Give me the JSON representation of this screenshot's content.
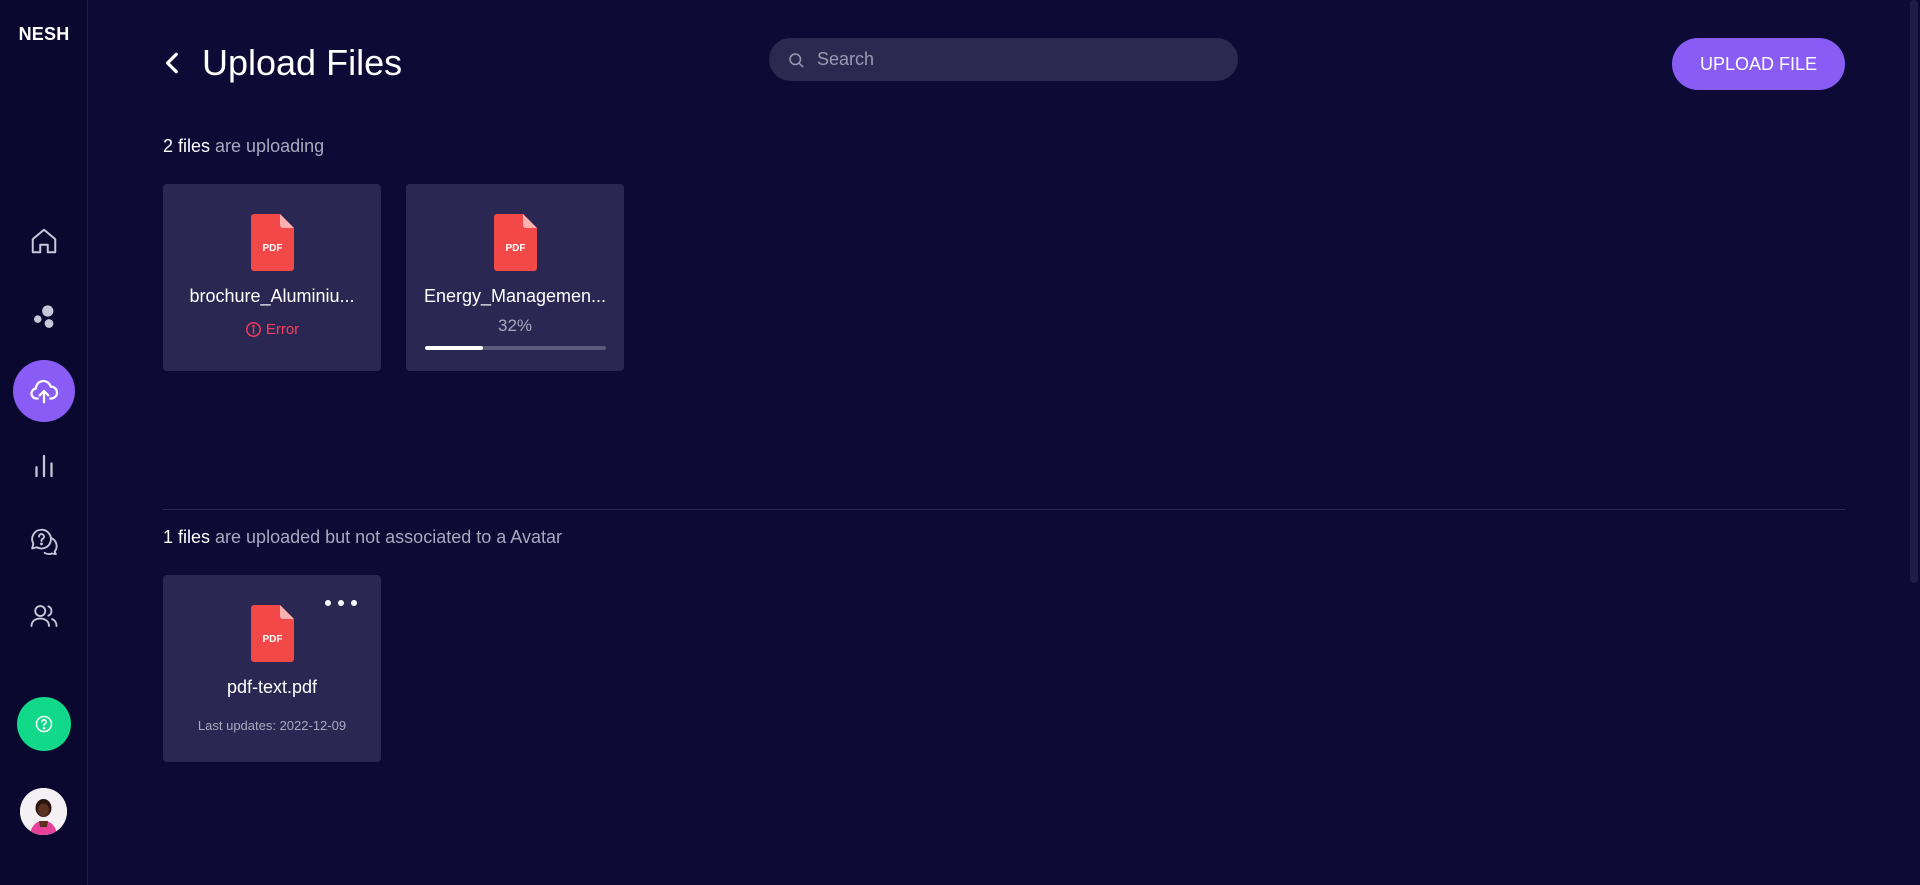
{
  "app": {
    "logo": "NESH"
  },
  "sidebar": {
    "items": [
      {
        "name": "home",
        "icon": "home-icon"
      },
      {
        "name": "avatars",
        "icon": "bubbles-icon"
      },
      {
        "name": "upload",
        "icon": "cloud-upload-icon",
        "active": true
      },
      {
        "name": "analytics",
        "icon": "bar-chart-icon"
      },
      {
        "name": "faq",
        "icon": "question-chat-icon"
      },
      {
        "name": "users",
        "icon": "users-icon"
      }
    ],
    "help_icon": "help-circle-icon",
    "avatar_icon": "user-avatar"
  },
  "header": {
    "title": "Upload Files",
    "search_placeholder": "Search",
    "upload_button": "UPLOAD FILE"
  },
  "uploading": {
    "count": "2 files",
    "suffix": " are uploading",
    "files": [
      {
        "name": "brochure_Aluminiu...",
        "status": "Error",
        "type": "PDF"
      },
      {
        "name": "Energy_Managemen...",
        "progress_label": "32%",
        "progress": 0.32,
        "type": "PDF"
      }
    ]
  },
  "uploaded": {
    "count": "1 files",
    "suffix": " are uploaded but not associated to a Avatar",
    "files": [
      {
        "name": "pdf-text.pdf",
        "updated": "Last updates: 2022-12-09",
        "type": "PDF"
      }
    ]
  },
  "colors": {
    "background": "#0d0a35",
    "accent": "#8a5cf6",
    "card": "#2a2852",
    "pdf_red": "#f24848",
    "error": "#ff3d5a",
    "help_green": "#12d88a"
  }
}
